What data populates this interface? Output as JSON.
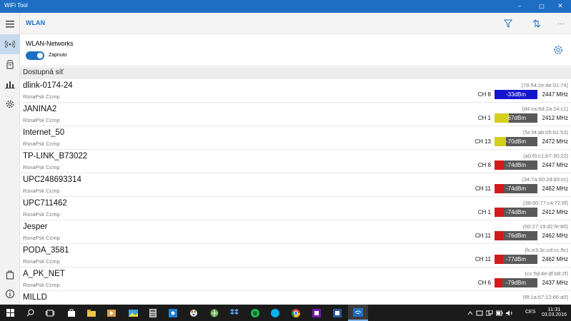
{
  "window": {
    "title": "WiFi Tool",
    "minimize": "–",
    "maximize": "□",
    "close": "✕"
  },
  "header": {
    "title": "WLAN",
    "more": "···"
  },
  "panel": {
    "label": "WLAN-Networks",
    "toggle_label": "Zapnuto",
    "toggle_on": true
  },
  "section": {
    "label": "Dostupná síť"
  },
  "networks": [
    {
      "ssid": "dlink-0174-24",
      "security": "RsnaPsk Ccmp",
      "mac": "(78:54:2e:4e:01:74)",
      "channel": "CH 8",
      "signal": "-33dBm",
      "signal_level": 1.0,
      "signal_color": "#1515d0",
      "frequency": "2447 MHz"
    },
    {
      "ssid": "JANINA2",
      "security": "RsnaPsk Ccmp",
      "mac": "(d4:ca:6d:2a:14:c1)",
      "channel": "CH 1",
      "signal": "-67dBm",
      "signal_level": 0.33,
      "signal_color": "#d4cf1a",
      "frequency": "2412 MHz"
    },
    {
      "ssid": "Internet_50",
      "security": "RsnaPsk Ccmp",
      "mac": "(5c:f4:ab:05:61:53)",
      "channel": "CH 13",
      "signal": "-70dBm",
      "signal_level": 0.27,
      "signal_color": "#d4cf1a",
      "frequency": "2472 MHz"
    },
    {
      "ssid": "TP-LINK_B73022",
      "security": "RsnaPsk Ccmp",
      "mac": "(a0:f3:c1:b7:30:22)",
      "channel": "CH 8",
      "signal": "-74dBm",
      "signal_level": 0.22,
      "signal_color": "#d41a1a",
      "frequency": "2447 MHz"
    },
    {
      "ssid": "UPC248693314",
      "security": "RsnaPsk Ccmp",
      "mac": "(34:7a:60:2d:d3:cc)",
      "channel": "CH 11",
      "signal": "-74dBm",
      "signal_level": 0.22,
      "signal_color": "#d41a1a",
      "frequency": "2462 MHz"
    },
    {
      "ssid": "UPC711462",
      "security": "RsnaPsk Ccmp",
      "mac": "(38:60:77:c4:72:5f)",
      "channel": "CH 1",
      "signal": "-74dBm",
      "signal_level": 0.22,
      "signal_color": "#d41a1a",
      "frequency": "2412 MHz"
    },
    {
      "ssid": "Jesper",
      "security": "RsnaPsk Ccmp",
      "mac": "(00:27:19:d2:fe:80)",
      "channel": "CH 11",
      "signal": "-76dBm",
      "signal_level": 0.2,
      "signal_color": "#d41a1a",
      "frequency": "2462 MHz"
    },
    {
      "ssid": "PODA_3581",
      "security": "RsnaPsk Ccmp",
      "mac": "(fc:e3:3c:cd:cc:8c)",
      "channel": "CH 11",
      "signal": "-77dBm",
      "signal_level": 0.2,
      "signal_color": "#d41a1a",
      "frequency": "2462 MHz"
    },
    {
      "ssid": "A_PK_NET",
      "security": "RsnaPsk Ccmp",
      "mac": "(cc:5d:4e:df:b8:2f)",
      "channel": "CH 6",
      "signal": "-79dBm",
      "signal_level": 0.18,
      "signal_color": "#d41a1a",
      "frequency": "2437 MHz"
    },
    {
      "ssid": "MILLD",
      "security": "",
      "mac": "(f8:1a:67:12:66:a0)",
      "channel": "",
      "signal": "",
      "signal_level": 0.18,
      "signal_color": "#d41a1a",
      "frequency": ""
    }
  ],
  "taskbar": {
    "apps": [
      "start-icon",
      "search-icon",
      "task-view-icon",
      "store-icon",
      "file-explorer-icon",
      "media-player-icon",
      "photos-icon",
      "calculator-icon",
      "weather-icon",
      "paint-icon",
      "browser-icon",
      "dropbox-icon",
      "spotify-icon",
      "skype-icon",
      "chrome-icon",
      "onenote-icon",
      "word-icon",
      "wifi-tool-icon"
    ],
    "language": "CES",
    "time": "11:31",
    "date": "03.03.2016"
  }
}
